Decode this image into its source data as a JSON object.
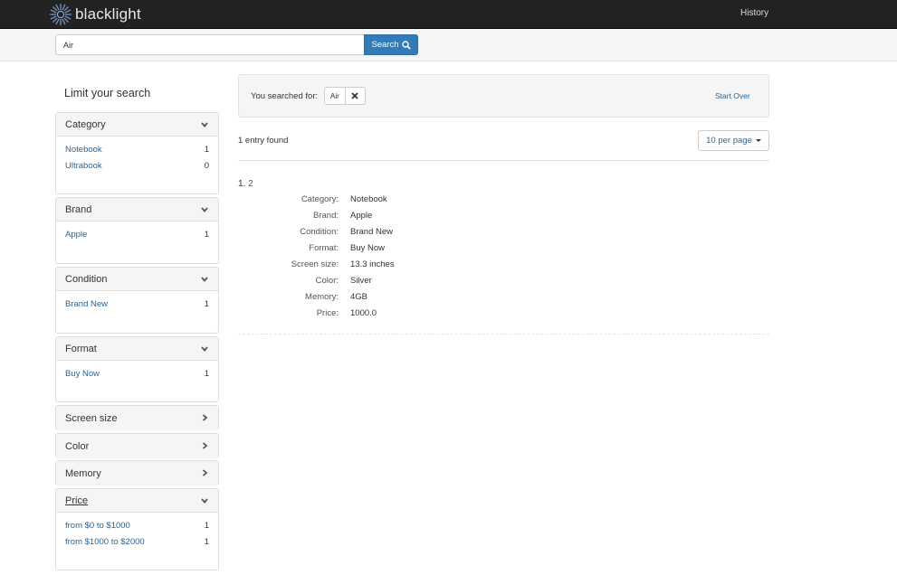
{
  "navbar": {
    "brand": "blacklight",
    "history": "History"
  },
  "search": {
    "value": "Air",
    "button_label": "Search"
  },
  "sidebar": {
    "title": "Limit your search",
    "facets": [
      {
        "label": "Category",
        "expanded": true,
        "items": [
          {
            "label": "Notebook",
            "count": "1"
          },
          {
            "label": "Ultrabook",
            "count": "0"
          }
        ]
      },
      {
        "label": "Brand",
        "expanded": true,
        "items": [
          {
            "label": "Apple",
            "count": "1"
          }
        ]
      },
      {
        "label": "Condition",
        "expanded": true,
        "items": [
          {
            "label": "Brand New",
            "count": "1"
          }
        ]
      },
      {
        "label": "Format",
        "expanded": true,
        "items": [
          {
            "label": "Buy Now",
            "count": "1"
          }
        ]
      },
      {
        "label": "Screen size",
        "expanded": false
      },
      {
        "label": "Color",
        "expanded": false
      },
      {
        "label": "Memory",
        "expanded": false
      },
      {
        "label": "Price",
        "expanded": true,
        "items": [
          {
            "label": "from $0 to $1000",
            "count": "1"
          },
          {
            "label": "from $1000 to $2000",
            "count": "1"
          }
        ]
      }
    ]
  },
  "constraints": {
    "label": "You searched for:",
    "value": "Air",
    "start_over": "Start Over"
  },
  "results": {
    "summary": "1 entry found",
    "per_page": "10 per page",
    "doc": {
      "index": "1.",
      "title": "2",
      "fields": [
        {
          "label": "Category:",
          "value": "Notebook"
        },
        {
          "label": "Brand:",
          "value": "Apple"
        },
        {
          "label": "Condition:",
          "value": "Brand New"
        },
        {
          "label": "Format:",
          "value": "Buy Now"
        },
        {
          "label": "Screen size:",
          "value": "13.3 inches"
        },
        {
          "label": "Color:",
          "value": "Silver"
        },
        {
          "label": "Memory:",
          "value": "4GB"
        },
        {
          "label": "Price:",
          "value": "1000.0"
        }
      ]
    }
  },
  "colors": {
    "navbar_bg": "#222222",
    "primary_button": "#337ab7",
    "link": "#2a6496"
  }
}
